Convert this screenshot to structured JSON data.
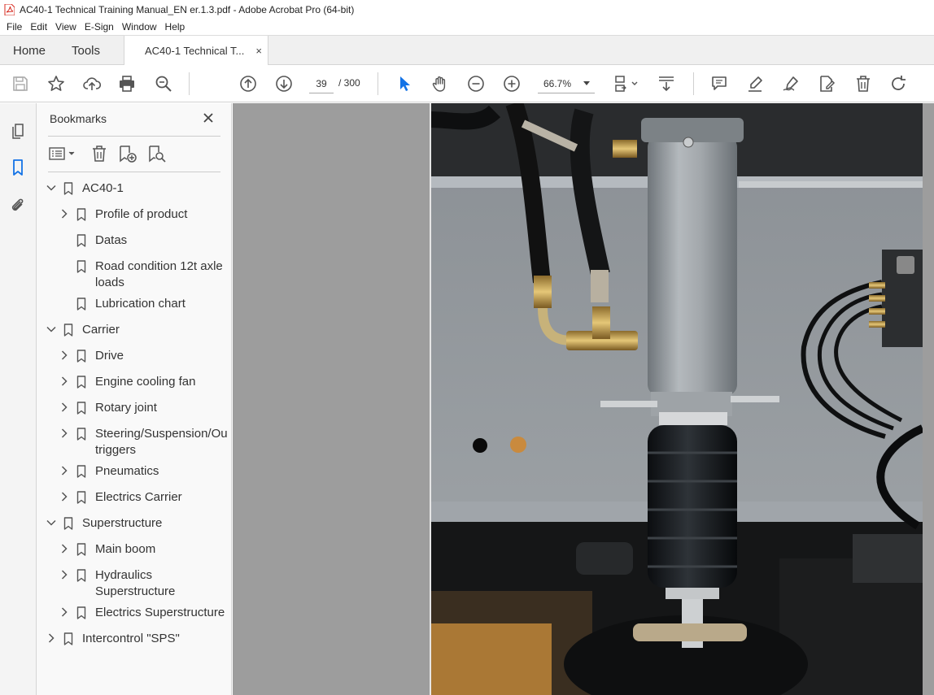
{
  "window": {
    "title": "AC40-1 Technical Training Manual_EN er.1.3.pdf - Adobe Acrobat Pro (64-bit)",
    "icon": "acrobat-pdf-icon"
  },
  "menu": [
    "File",
    "Edit",
    "View",
    "E-Sign",
    "Window",
    "Help"
  ],
  "tabs": {
    "home": "Home",
    "tools": "Tools",
    "document": "AC40-1 Technical T...",
    "close": "×"
  },
  "toolbar": {
    "page_current": "39",
    "page_total": "/  300",
    "zoom": "66.7%"
  },
  "bookmarks": {
    "title": "Bookmarks",
    "items": [
      {
        "label": "AC40-1",
        "level": 0,
        "expanded": true,
        "has_children": true
      },
      {
        "label": "Profile of product",
        "level": 1,
        "has_children": true
      },
      {
        "label": "Datas",
        "level": 1,
        "has_children": false
      },
      {
        "label": "Road condition 12t axle",
        "label2": "loads",
        "level": 1,
        "has_children": false
      },
      {
        "label": "Lubrication chart",
        "level": 1,
        "has_children": false
      },
      {
        "label": "Carrier",
        "level": 0,
        "expanded": true,
        "has_children": true
      },
      {
        "label": "Drive",
        "level": 1,
        "has_children": true
      },
      {
        "label": "Engine cooling fan",
        "level": 1,
        "has_children": true
      },
      {
        "label": "Rotary joint",
        "level": 1,
        "has_children": true
      },
      {
        "label": "Steering/Suspension/Ou",
        "label2": "triggers",
        "level": 1,
        "has_children": true
      },
      {
        "label": "Pneumatics",
        "level": 1,
        "has_children": true
      },
      {
        "label": "Electrics Carrier",
        "level": 1,
        "has_children": true
      },
      {
        "label": "Superstructure",
        "level": 0,
        "expanded": true,
        "has_children": true
      },
      {
        "label": "Main boom",
        "level": 1,
        "has_children": true
      },
      {
        "label": "Hydraulics",
        "label2": "Superstructure",
        "level": 1,
        "has_children": true
      },
      {
        "label": "Electrics Superstructure",
        "level": 1,
        "has_children": true
      },
      {
        "label": "Intercontrol \"SPS\"",
        "level": 0,
        "expanded": false,
        "has_children": true
      }
    ]
  },
  "colors": {
    "accent_blue": "#1473e6",
    "pdf_red": "#d7281e",
    "panel_bg": "#f9f9f9",
    "doc_bg": "#9d9d9d"
  }
}
